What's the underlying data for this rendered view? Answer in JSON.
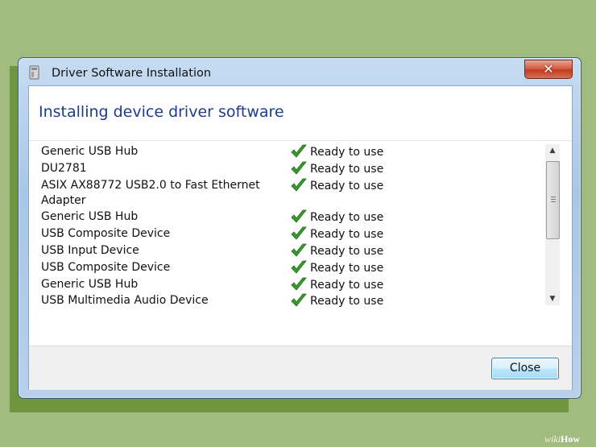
{
  "window": {
    "title": "Driver Software Installation",
    "heading": "Installing device driver software",
    "close_button_label": "Close"
  },
  "devices": [
    {
      "name": "Generic USB Hub",
      "status": "Ready to use"
    },
    {
      "name": "DU2781",
      "status": "Ready to use"
    },
    {
      "name": "ASIX AX88772 USB2.0 to Fast Ethernet",
      "name_line2": "Adapter",
      "status": "Ready to use"
    },
    {
      "name": "Generic USB Hub",
      "status": "Ready to use"
    },
    {
      "name": "USB Composite Device",
      "status": "Ready to use"
    },
    {
      "name": "USB Input Device",
      "status": "Ready to use"
    },
    {
      "name": "USB Composite Device",
      "status": "Ready to use"
    },
    {
      "name": "Generic USB Hub",
      "status": "Ready to use"
    },
    {
      "name": "USB Multimedia Audio Device",
      "status": "Ready to use"
    }
  ],
  "icons": {
    "status": "green-check-icon",
    "titlebar": "driver-icon",
    "close": "close-icon"
  },
  "colors": {
    "heading": "#1c3d8a",
    "check": "#3a9a2c",
    "close_button_red": "#c0391e"
  },
  "watermark": {
    "prefix": "wiki",
    "suffix": "How"
  }
}
